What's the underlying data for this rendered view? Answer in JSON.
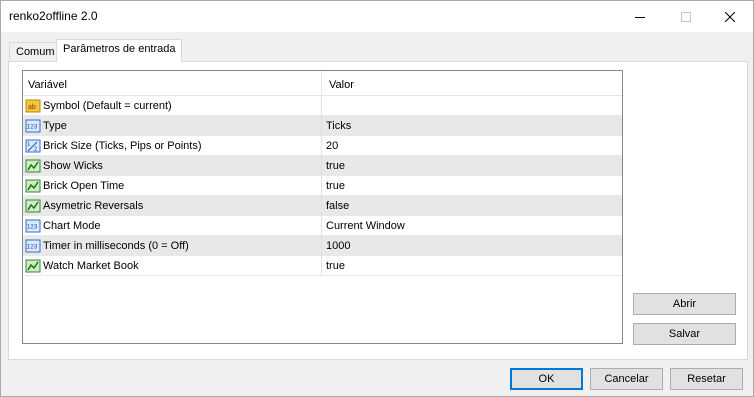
{
  "window": {
    "title": "renko2offline 2.0"
  },
  "tabs": [
    {
      "label": "Comum",
      "active": false
    },
    {
      "label": "Parâmetros de entrada",
      "active": true
    }
  ],
  "grid": {
    "columns": [
      "Variável",
      "Valor"
    ],
    "rows": [
      {
        "icon": "string-icon",
        "name": "Symbol (Default = current)",
        "value": ""
      },
      {
        "icon": "integer-icon",
        "name": "Type",
        "value": "Ticks"
      },
      {
        "icon": "double-icon",
        "name": "Brick Size (Ticks, Pips or Points)",
        "value": "20"
      },
      {
        "icon": "bool-icon",
        "name": "Show Wicks",
        "value": "true"
      },
      {
        "icon": "bool-icon",
        "name": "Brick Open Time",
        "value": "true"
      },
      {
        "icon": "bool-icon",
        "name": "Asymetric Reversals",
        "value": "false"
      },
      {
        "icon": "integer-icon",
        "name": "Chart Mode",
        "value": "Current Window"
      },
      {
        "icon": "integer-icon",
        "name": "Timer in milliseconds (0 = Off)",
        "value": "1000"
      },
      {
        "icon": "bool-icon",
        "name": "Watch Market Book",
        "value": "true"
      }
    ]
  },
  "side_buttons": {
    "open_label": "Abrir",
    "save_label": "Salvar"
  },
  "footer_buttons": {
    "ok_label": "OK",
    "cancel_label": "Cancelar",
    "reset_label": "Resetar"
  },
  "colors": {
    "primary_border": "#0078d7",
    "alt_row": "#e8e8e8"
  }
}
